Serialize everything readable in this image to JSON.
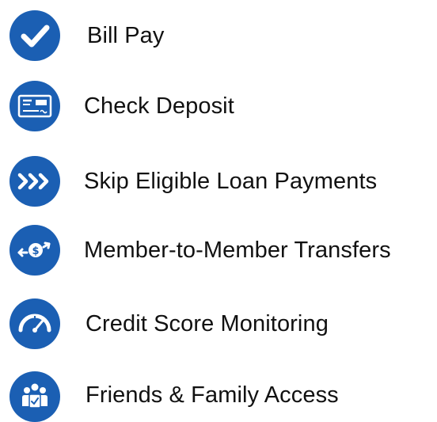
{
  "colors": {
    "accent": "#1b5fb3",
    "text": "#111111",
    "background": "#ffffff"
  },
  "features": [
    {
      "label": "Bill Pay",
      "icon": "checkmark-icon"
    },
    {
      "label": "Check Deposit",
      "icon": "check-document-icon"
    },
    {
      "label": "Skip Eligible Loan Payments",
      "icon": "triple-chevron-right-icon"
    },
    {
      "label": "Member-to-Member Transfers",
      "icon": "dollar-transfer-icon"
    },
    {
      "label": "Credit Score Monitoring",
      "icon": "gauge-icon"
    },
    {
      "label": "Friends & Family Access",
      "icon": "family-access-icon"
    }
  ]
}
